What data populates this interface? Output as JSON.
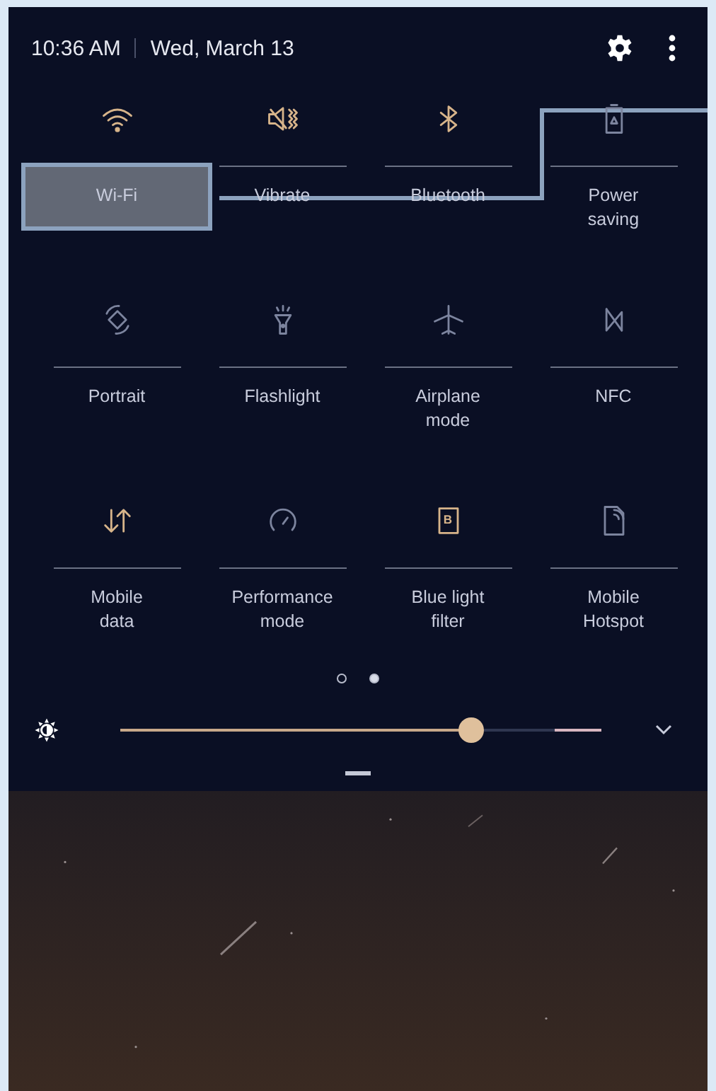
{
  "status": {
    "time": "10:36 AM",
    "date": "Wed, March 13"
  },
  "tiles": [
    {
      "label": "Wi-Fi",
      "kind": "wifi",
      "on": true,
      "highlighted": true
    },
    {
      "label": "Vibrate",
      "kind": "vibrate",
      "on": true,
      "highlighted": false
    },
    {
      "label": "Bluetooth",
      "kind": "bluetooth",
      "on": true,
      "highlighted": false
    },
    {
      "label": "Power saving",
      "kind": "battery",
      "on": false,
      "highlighted": false
    },
    {
      "label": "Portrait",
      "kind": "rotate",
      "on": false,
      "highlighted": false
    },
    {
      "label": "Flashlight",
      "kind": "flashlight",
      "on": false,
      "highlighted": false
    },
    {
      "label": "Airplane mode",
      "kind": "airplane",
      "on": false,
      "highlighted": false
    },
    {
      "label": "NFC",
      "kind": "nfc",
      "on": false,
      "highlighted": false
    },
    {
      "label": "Mobile data",
      "kind": "data",
      "on": true,
      "highlighted": false
    },
    {
      "label": "Performance mode",
      "kind": "gauge",
      "on": false,
      "highlighted": false
    },
    {
      "label": "Blue light filter",
      "kind": "bluelight",
      "glyph": "B",
      "on": true,
      "highlighted": false
    },
    {
      "label": "Mobile Hotspot",
      "kind": "hotspot",
      "on": false,
      "highlighted": false
    }
  ],
  "pages": [
    {
      "selected": false
    },
    {
      "selected": true
    }
  ],
  "brightness": {
    "level": 0.73
  }
}
